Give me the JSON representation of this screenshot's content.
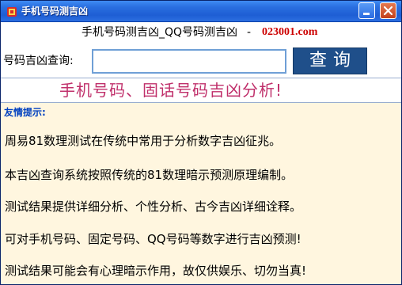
{
  "window": {
    "title": "手机号码测吉凶",
    "icon": "app-icon",
    "minimize_icon": "minimize-icon",
    "close_icon": "close-icon"
  },
  "header": {
    "title": "手机号码测吉凶_QQ号码测吉凶",
    "separator": "-",
    "link": "023001.com"
  },
  "query": {
    "label": "号码吉凶查询:",
    "input_value": "",
    "button_label": "查询"
  },
  "banner": {
    "text": "手机号码、固话号码吉凶分析!"
  },
  "tips": {
    "title": "友情提示:",
    "lines": [
      "周易81数理测试在传统中常用于分析数字吉凶征兆。",
      "本吉凶查询系统按照传统的81数理暗示预测原理编制。",
      "测试结果提供详细分析、个性分析、古今吉凶详细诠释。",
      "可对手机号码、固定号码、QQ号码等数字进行吉凶预测!",
      "测试结果可能会有心理暗示作用，故仅供娱乐、切勿当真!"
    ]
  },
  "colors": {
    "titlebar": "#2a6fe0",
    "link": "#cc0000",
    "banner_text": "#c0306b",
    "tip_title": "#0040c0",
    "content_bg": "#fff6df",
    "button_bg": "#1f4f8a"
  }
}
